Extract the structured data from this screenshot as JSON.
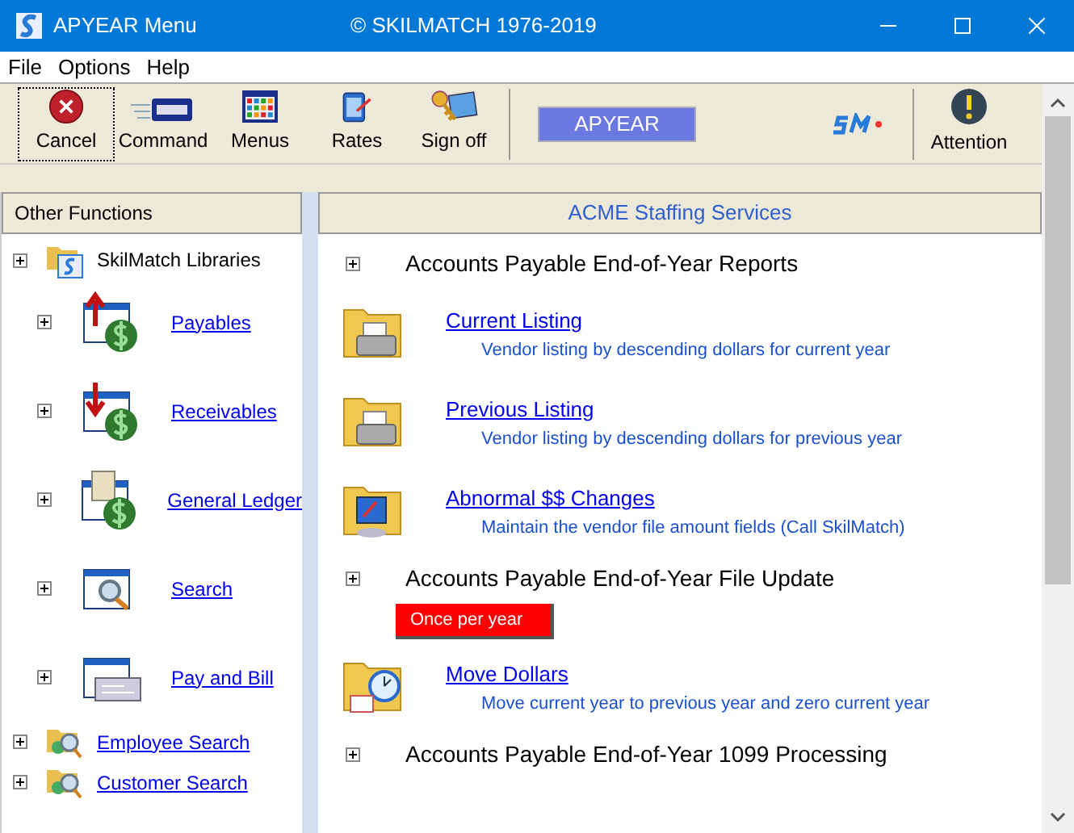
{
  "window": {
    "title": "APYEAR Menu",
    "copyright": "© SKILMATCH 1976-2019"
  },
  "menu": [
    {
      "label": "File"
    },
    {
      "label": "Options"
    },
    {
      "label": "Help"
    }
  ],
  "toolbar": [
    {
      "kind": "cancel",
      "label": "Cancel",
      "focused": true
    },
    {
      "kind": "command",
      "label": "Command",
      "focused": false
    },
    {
      "kind": "menus",
      "label": "Menus",
      "focused": false
    },
    {
      "kind": "rates",
      "label": "Rates",
      "focused": false
    },
    {
      "kind": "signoff",
      "label": "Sign off",
      "focused": false
    }
  ],
  "program_name": "APYEAR",
  "attention": {
    "label": "Attention"
  },
  "left_panel": {
    "title": "Other Functions",
    "items": [
      {
        "kind": "library",
        "label": "SkilMatch Libraries",
        "link": false,
        "children": [
          {
            "kind": "payables",
            "label": "Payables",
            "link": true
          },
          {
            "kind": "receivables",
            "label": "Receivables",
            "link": true
          },
          {
            "kind": "ledger",
            "label": "General Ledger",
            "link": true
          },
          {
            "kind": "search",
            "label": "Search",
            "link": true
          },
          {
            "kind": "paybill",
            "label": "Pay and Bill",
            "link": true
          }
        ]
      },
      {
        "kind": "people",
        "label": "Employee Search",
        "link": true
      },
      {
        "kind": "people",
        "label": "Customer Search",
        "link": true
      }
    ]
  },
  "right_panel": {
    "title": "ACME Staffing Services",
    "items": [
      {
        "kind": "section",
        "label": "Accounts Payable End-of-Year Reports"
      },
      {
        "kind": "printer-action",
        "label": "Current Listing",
        "description": "Vendor listing by descending dollars for current year"
      },
      {
        "kind": "printer-action",
        "label": "Previous Listing",
        "description": "Vendor listing by descending dollars for previous year"
      },
      {
        "kind": "computer-action",
        "label": "Abnormal $$ Changes",
        "description": "Maintain the vendor file amount fields (Call SkilMatch)"
      },
      {
        "kind": "section",
        "label": "Accounts Payable End-of-Year File Update"
      },
      {
        "kind": "badge",
        "label": "Once per year"
      },
      {
        "kind": "clock-action",
        "label": "Move Dollars",
        "description": "Move current year to previous year and zero current year"
      },
      {
        "kind": "section",
        "label": "Accounts Payable End-of-Year 1099 Processing"
      }
    ]
  }
}
